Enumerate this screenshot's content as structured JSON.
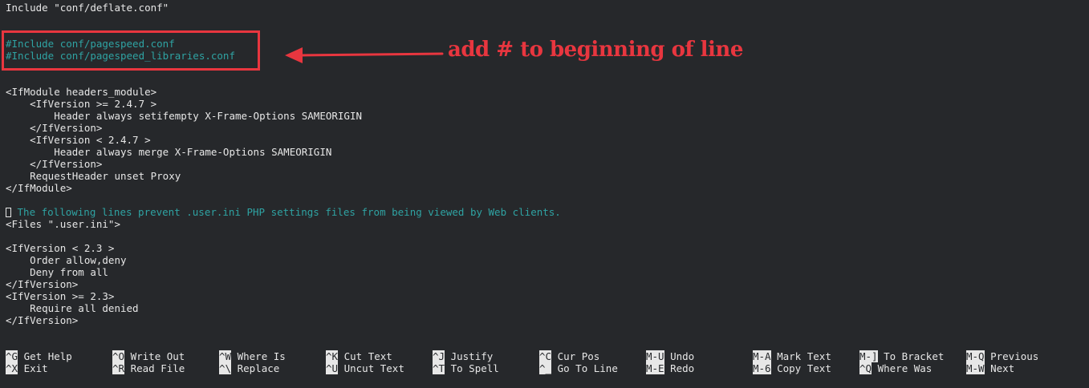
{
  "editor": {
    "lines": [
      {
        "text": "Include \"conf/deflate.conf\"",
        "type": "code"
      },
      {
        "text": "",
        "type": "code"
      },
      {
        "text": "",
        "type": "code"
      },
      {
        "text": "#Include conf/pagespeed.conf",
        "type": "comment"
      },
      {
        "text": "#Include conf/pagespeed_libraries.conf",
        "type": "comment"
      },
      {
        "text": "",
        "type": "code"
      },
      {
        "text": "",
        "type": "code"
      },
      {
        "text": "<IfModule headers_module>",
        "type": "code"
      },
      {
        "text": "    <IfVersion >= 2.4.7 >",
        "type": "code"
      },
      {
        "text": "        Header always setifempty X-Frame-Options SAMEORIGIN",
        "type": "code"
      },
      {
        "text": "    </IfVersion>",
        "type": "code"
      },
      {
        "text": "    <IfVersion < 2.4.7 >",
        "type": "code"
      },
      {
        "text": "        Header always merge X-Frame-Options SAMEORIGIN",
        "type": "code"
      },
      {
        "text": "    </IfVersion>",
        "type": "code"
      },
      {
        "text": "    RequestHeader unset Proxy",
        "type": "code"
      },
      {
        "text": "</IfModule>",
        "type": "code"
      },
      {
        "text": "",
        "type": "code"
      },
      {
        "text": " The following lines prevent .user.ini PHP settings files from being viewed by Web clients.",
        "type": "cursor-comment"
      },
      {
        "text": "<Files \".user.ini\">",
        "type": "code"
      },
      {
        "text": "",
        "type": "code"
      },
      {
        "text": "<IfVersion < 2.3 >",
        "type": "code"
      },
      {
        "text": "    Order allow,deny",
        "type": "code"
      },
      {
        "text": "    Deny from all",
        "type": "code"
      },
      {
        "text": "</IfVersion>",
        "type": "code"
      },
      {
        "text": "<IfVersion >= 2.3>",
        "type": "code"
      },
      {
        "text": "    Require all denied",
        "type": "code"
      },
      {
        "text": "</IfVersion>",
        "type": "code"
      }
    ]
  },
  "annotation": {
    "text": "add # to beginning of line",
    "color": "#e8363f"
  },
  "shortcuts": {
    "row1": [
      {
        "key": "^G",
        "label": "Get Help"
      },
      {
        "key": "^O",
        "label": "Write Out"
      },
      {
        "key": "^W",
        "label": "Where Is"
      },
      {
        "key": "^K",
        "label": "Cut Text"
      },
      {
        "key": "^J",
        "label": "Justify"
      },
      {
        "key": "^C",
        "label": "Cur Pos"
      },
      {
        "key": "M-U",
        "label": "Undo"
      },
      {
        "key": "M-A",
        "label": "Mark Text"
      },
      {
        "key": "M-]",
        "label": "To Bracket"
      },
      {
        "key": "M-Q",
        "label": "Previous"
      }
    ],
    "row2": [
      {
        "key": "^X",
        "label": "Exit"
      },
      {
        "key": "^R",
        "label": "Read File"
      },
      {
        "key": "^\\",
        "label": "Replace"
      },
      {
        "key": "^U",
        "label": "Uncut Text"
      },
      {
        "key": "^T",
        "label": "To Spell"
      },
      {
        "key": "^_",
        "label": "Go To Line"
      },
      {
        "key": "M-E",
        "label": "Redo"
      },
      {
        "key": "M-6",
        "label": "Copy Text"
      },
      {
        "key": "^Q",
        "label": "Where Was"
      },
      {
        "key": "M-W",
        "label": "Next"
      }
    ]
  },
  "colors": {
    "background": "#26282b",
    "text": "#e7e7e7",
    "comment": "#2fa3a3",
    "annotation": "#e8363f"
  }
}
